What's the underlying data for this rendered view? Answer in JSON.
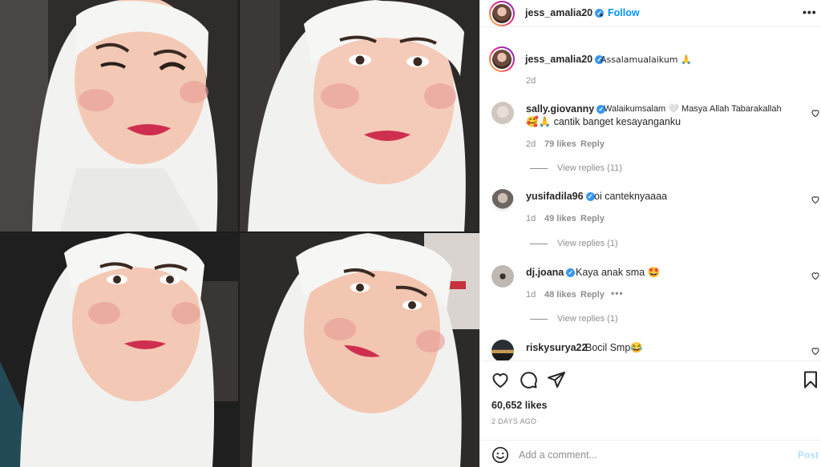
{
  "post": {
    "author": "jess_amalia20",
    "follow_label": "Follow",
    "more_label": "•••",
    "caption": "Assalamualaikum 🙏",
    "caption_age": "2d",
    "likes": "60,652 likes",
    "posted": "2 DAYS AGO"
  },
  "comments": [
    {
      "user": "sally.giovanny",
      "text_line1": "Walaikumsalam 🤍 Masya Allah Tabarakallah",
      "text_line2": "🥰🙏 cantik banget kesayanganku",
      "age": "2d",
      "likes": "79 likes",
      "reply": "Reply",
      "view_replies": "View replies (11)"
    },
    {
      "user": "yusifadila96",
      "text_line1": "oi canteknyaaaa",
      "age": "1d",
      "likes": "49 likes",
      "reply": "Reply",
      "view_replies": "View replies (1)"
    },
    {
      "user": "dj.joana",
      "text_line1": "Kaya anak sma 🤩",
      "age": "1d",
      "likes": "48 likes",
      "reply": "Reply",
      "more": "•••",
      "view_replies": "View replies (1)"
    },
    {
      "user": "riskysurya22",
      "text_line1": "Bocil Smp😂"
    }
  ],
  "comment_box": {
    "placeholder": "Add a comment...",
    "post_label": "Post"
  },
  "colors": {
    "accent": "#0095f6",
    "verified": "#3897f0",
    "muted": "#8e8e8e"
  },
  "icons": [
    "heart-icon",
    "comment-icon",
    "share-icon",
    "bookmark-icon",
    "emoji-icon",
    "verified-icon",
    "more-icon"
  ]
}
